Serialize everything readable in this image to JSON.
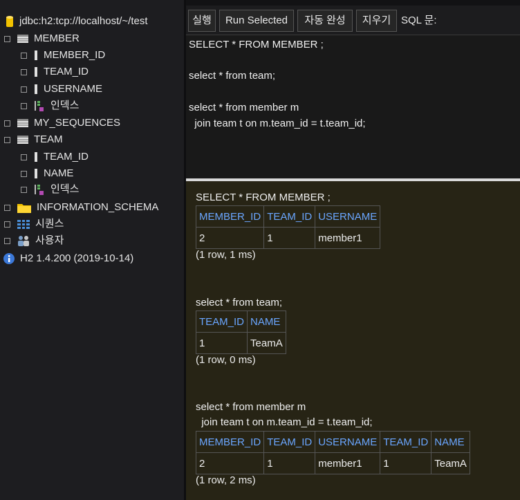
{
  "tree": {
    "connection": "jdbc:h2:tcp://localhost/~/test",
    "member": {
      "label": "MEMBER",
      "columns": [
        "MEMBER_ID",
        "TEAM_ID",
        "USERNAME"
      ],
      "index": "인덱스"
    },
    "my_sequences": "MY_SEQUENCES",
    "team": {
      "label": "TEAM",
      "columns": [
        "TEAM_ID",
        "NAME"
      ],
      "index": "인덱스"
    },
    "information_schema": "INFORMATION_SCHEMA",
    "sequences": "시퀀스",
    "users": "사용자",
    "version": "H2 1.4.200 (2019-10-14)"
  },
  "toolbar": {
    "run": "실행",
    "run_selected": "Run Selected",
    "autocomplete": "자동 완성",
    "clear": "지우기",
    "sql_label": "SQL 문:"
  },
  "editor": {
    "lines": [
      "SELECT * FROM MEMBER ;",
      "select * from team;",
      "select * from member m",
      "  join team t on m.team_id = t.team_id;"
    ]
  },
  "results": {
    "q1": {
      "sql": "SELECT * FROM MEMBER ;",
      "headers": [
        "MEMBER_ID",
        "TEAM_ID",
        "USERNAME"
      ],
      "row": [
        "2",
        "1",
        "member1"
      ],
      "status": "(1 row, 1 ms)"
    },
    "q2": {
      "sql": "select * from team;",
      "headers": [
        "TEAM_ID",
        "NAME"
      ],
      "row": [
        "1",
        "TeamA"
      ],
      "status": "(1 row, 0 ms)"
    },
    "q3": {
      "sql1": "select * from member m",
      "sql2": "  join team t on m.team_id = t.team_id;",
      "headers": [
        "MEMBER_ID",
        "TEAM_ID",
        "USERNAME",
        "TEAM_ID",
        "NAME"
      ],
      "row": [
        "2",
        "1",
        "member1",
        "1",
        "TeamA"
      ],
      "status": "(1 row, 2 ms)"
    }
  },
  "colors": {
    "header_text": "#6aa6ff",
    "results_bg": "#272415",
    "db_icon": "#f2c200",
    "folder_icon": "#f2c200",
    "info_icon": "#3b78d8"
  },
  "icons": [
    "database-icon",
    "table-icon",
    "column-icon",
    "index-icon",
    "folder-icon",
    "sequence-icon",
    "users-icon",
    "info-icon"
  ]
}
